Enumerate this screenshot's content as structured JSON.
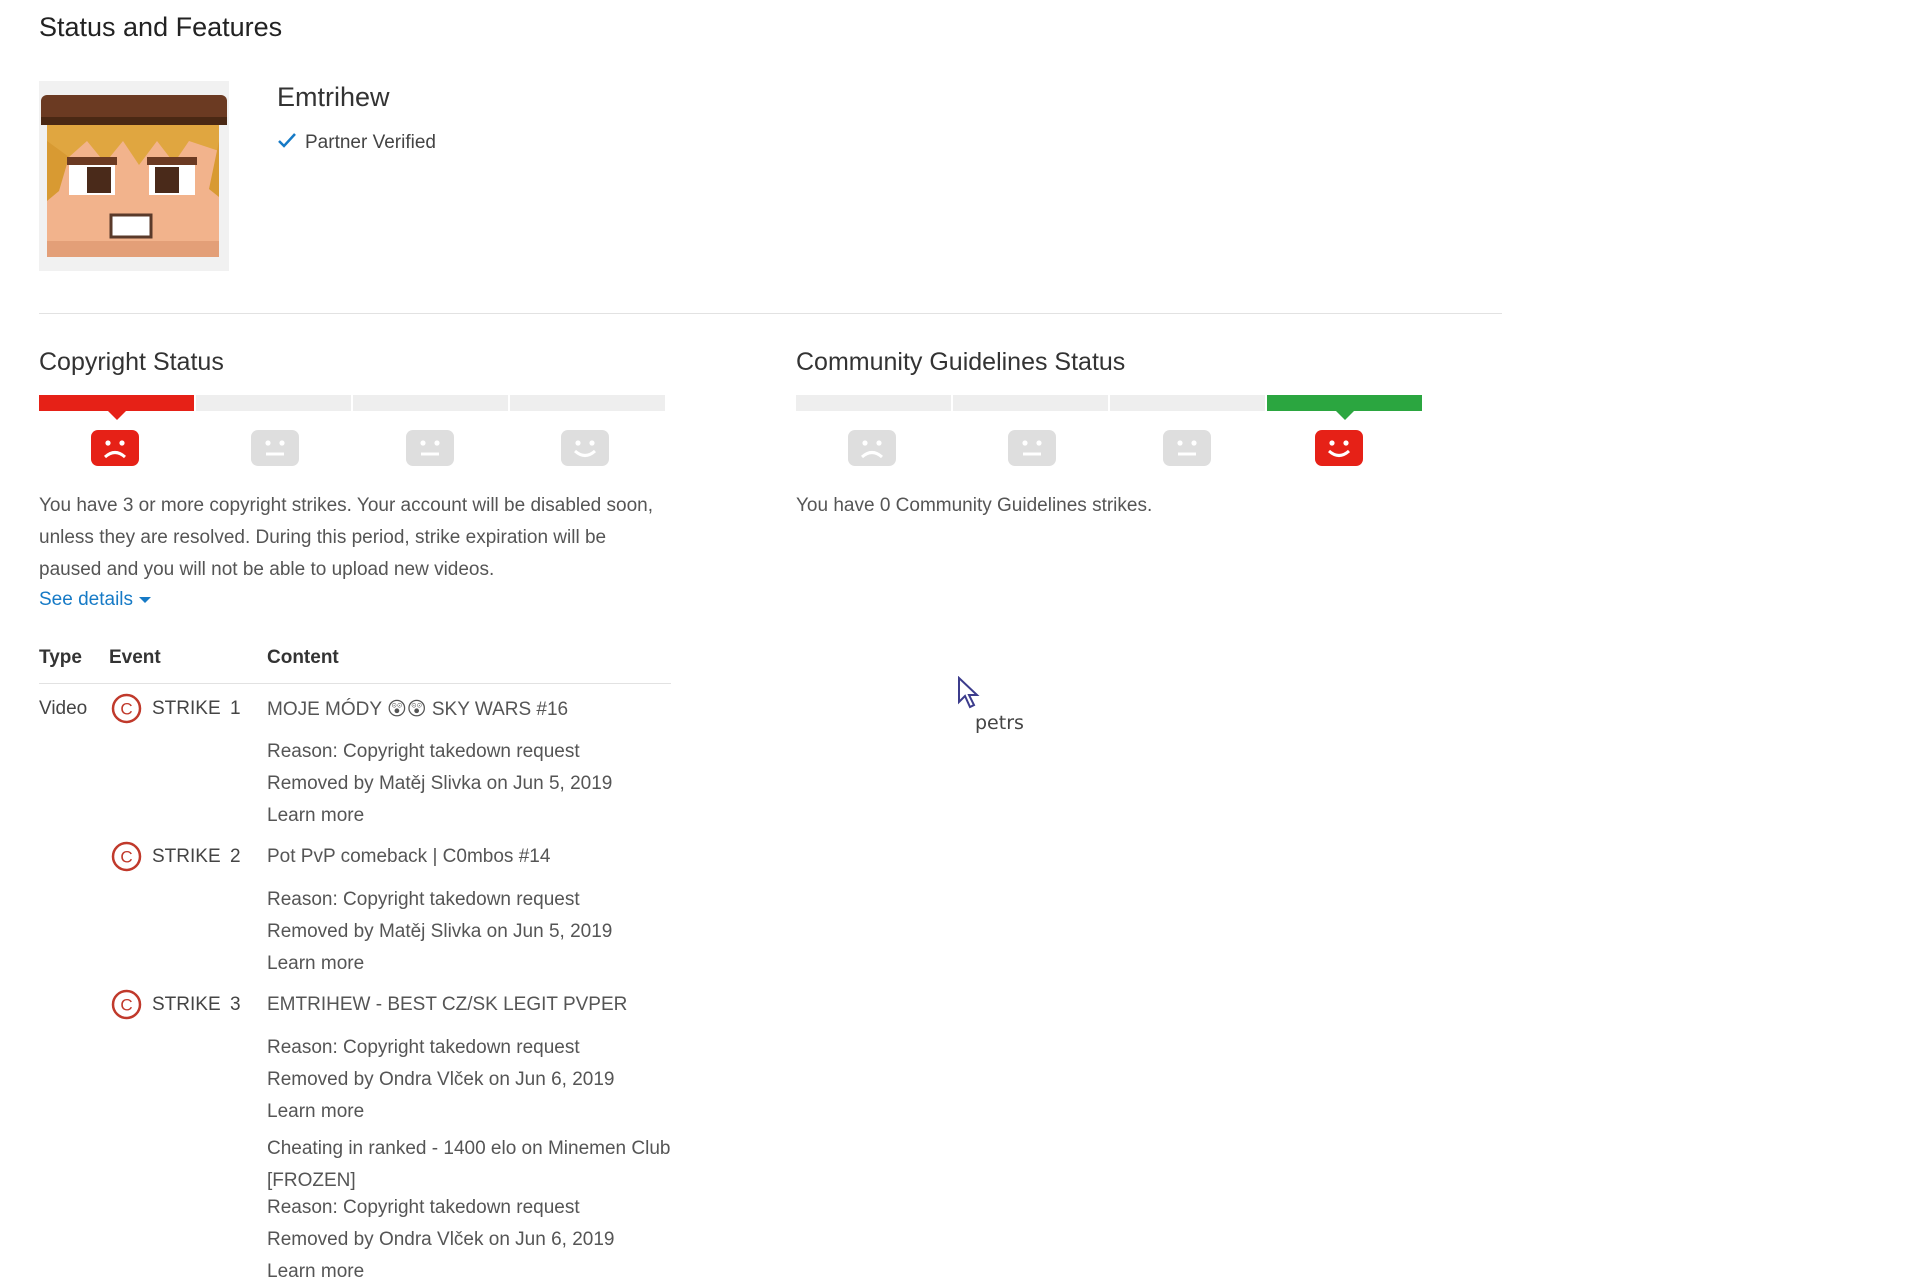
{
  "page": {
    "title": "Status and Features"
  },
  "channel": {
    "name": "Emtrihew",
    "verified_label": "Partner Verified"
  },
  "copyright": {
    "title": "Copyright Status",
    "strikes_active_segment": 1,
    "message": "You have 3 or more copyright strikes. Your account will be disabled soon, unless they are resolved. During this period, strike expiration will be paused and you will not be able to upload new videos.",
    "see_details_label": "See details",
    "table": {
      "headers": {
        "type": "Type",
        "event": "Event",
        "content": "Content"
      },
      "rows": [
        {
          "type": "Video",
          "event": "STRIKE",
          "number": "1",
          "title": "MOJE MÓDY 😲😲 SKY WARS #16",
          "reason": "Reason: Copyright takedown request",
          "removed": "Removed by Matěj Slivka on Jun 5, 2019",
          "learn_more": "Learn more"
        },
        {
          "type": "",
          "event": "STRIKE",
          "number": "2",
          "title": "Pot PvP comeback | C0mbos #14",
          "reason": "Reason: Copyright takedown request",
          "removed": "Removed by Matěj Slivka on Jun 5, 2019",
          "learn_more": "Learn more"
        },
        {
          "type": "",
          "event": "STRIKE",
          "number": "3",
          "title": "EMTRIHEW - BEST CZ/SK LEGIT PVPER",
          "reason": "Reason: Copyright takedown request",
          "removed": "Removed by Ondra Vlček on Jun 6, 2019",
          "learn_more": "Learn more",
          "title_2": "Cheating in ranked - 1400 elo on Minemen Club [FROZEN]",
          "reason_2": "Reason: Copyright takedown request",
          "removed_2": "Removed by Ondra Vlček on Jun 6, 2019",
          "learn_more_2": "Learn more"
        }
      ]
    }
  },
  "community": {
    "title": "Community Guidelines Status",
    "active_segment": 4,
    "message": "You have 0 Community Guidelines strikes."
  },
  "cursor": {
    "label": "petrs"
  },
  "colors": {
    "link": "#167ac6",
    "strike_red": "#e62117",
    "good_green": "#2ba640",
    "inactive_grey": "#eeeeee"
  }
}
